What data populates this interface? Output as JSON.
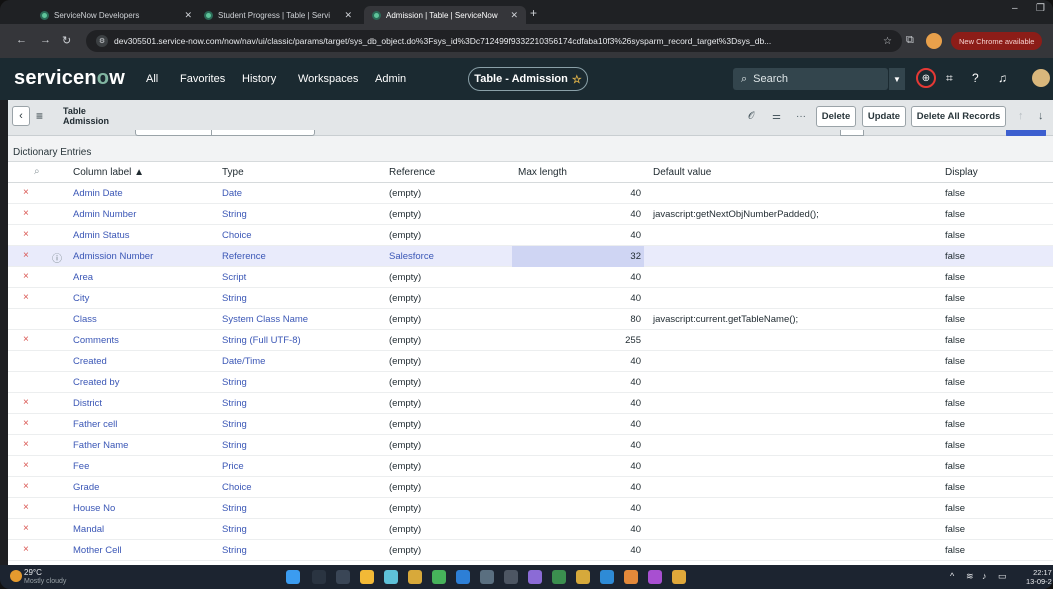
{
  "browser": {
    "tabs": [
      {
        "title": "ServiceNow Developers",
        "active": false
      },
      {
        "title": "Student Progress | Table | Servi",
        "active": false
      },
      {
        "title": "Admission | Table | ServiceNow",
        "active": true
      }
    ],
    "new_tab": "+",
    "url": "dev305501.service-now.com/now/nav/ui/classic/params/target/sys_db_object.do%3Fsys_id%3Dc712499f9332210356174cdfaba10f3%26sysparm_record_target%3Dsys_db...",
    "update_pill": "New Chrome available"
  },
  "header": {
    "logo_left": "servicen",
    "logo_o": "o",
    "logo_right": "w",
    "menu": [
      "All",
      "Favorites",
      "History",
      "Workspaces",
      "Admin"
    ],
    "context": "Table - Admission",
    "context_star": "☆",
    "search_placeholder": "Search"
  },
  "form": {
    "title_line1": "Table",
    "title_line2": "Admission",
    "buttons": {
      "delete": "Delete",
      "update": "Update",
      "delete_all": "Delete All Records"
    }
  },
  "related_list": {
    "title": "Dictionary Entries",
    "columns": {
      "label": "Column label ▲",
      "type": "Type",
      "reference": "Reference",
      "max_length": "Max length",
      "default_value": "Default value",
      "display": "Display"
    },
    "rows": [
      {
        "del": "×",
        "info": "",
        "label": "Admin Date",
        "type": "Date",
        "reference": "(empty)",
        "max": "40",
        "default": "",
        "display": "false"
      },
      {
        "del": "×",
        "info": "",
        "label": "Admin Number",
        "type": "String",
        "reference": "(empty)",
        "max": "40",
        "default": "javascript:getNextObjNumberPadded();",
        "display": "false"
      },
      {
        "del": "×",
        "info": "",
        "label": "Admin Status",
        "type": "Choice",
        "reference": "(empty)",
        "max": "40",
        "default": "",
        "display": "false"
      },
      {
        "del": "×",
        "info": "ⓘ",
        "label": "Admission Number",
        "type": "Reference",
        "reference": "Salesforce",
        "max": "32",
        "default": "",
        "display": "false"
      },
      {
        "del": "×",
        "info": "",
        "label": "Area",
        "type": "Script",
        "reference": "(empty)",
        "max": "40",
        "default": "",
        "display": "false"
      },
      {
        "del": "×",
        "info": "",
        "label": "City",
        "type": "String",
        "reference": "(empty)",
        "max": "40",
        "default": "",
        "display": "false"
      },
      {
        "del": "",
        "info": "",
        "label": "Class",
        "type": "System Class Name",
        "reference": "(empty)",
        "max": "80",
        "default": "javascript:current.getTableName();",
        "display": "false"
      },
      {
        "del": "×",
        "info": "",
        "label": "Comments",
        "type": "String (Full UTF-8)",
        "reference": "(empty)",
        "max": "255",
        "default": "",
        "display": "false"
      },
      {
        "del": "",
        "info": "",
        "label": "Created",
        "type": "Date/Time",
        "reference": "(empty)",
        "max": "40",
        "default": "",
        "display": "false"
      },
      {
        "del": "",
        "info": "",
        "label": "Created by",
        "type": "String",
        "reference": "(empty)",
        "max": "40",
        "default": "",
        "display": "false"
      },
      {
        "del": "×",
        "info": "",
        "label": "District",
        "type": "String",
        "reference": "(empty)",
        "max": "40",
        "default": "",
        "display": "false"
      },
      {
        "del": "×",
        "info": "",
        "label": "Father cell",
        "type": "String",
        "reference": "(empty)",
        "max": "40",
        "default": "",
        "display": "false"
      },
      {
        "del": "×",
        "info": "",
        "label": "Father Name",
        "type": "String",
        "reference": "(empty)",
        "max": "40",
        "default": "",
        "display": "false"
      },
      {
        "del": "×",
        "info": "",
        "label": "Fee",
        "type": "Price",
        "reference": "(empty)",
        "max": "40",
        "default": "",
        "display": "false"
      },
      {
        "del": "×",
        "info": "",
        "label": "Grade",
        "type": "Choice",
        "reference": "(empty)",
        "max": "40",
        "default": "",
        "display": "false"
      },
      {
        "del": "×",
        "info": "",
        "label": "House No",
        "type": "String",
        "reference": "(empty)",
        "max": "40",
        "default": "",
        "display": "false"
      },
      {
        "del": "×",
        "info": "",
        "label": "Mandal",
        "type": "String",
        "reference": "(empty)",
        "max": "40",
        "default": "",
        "display": "false"
      },
      {
        "del": "×",
        "info": "",
        "label": "Mother Cell",
        "type": "String",
        "reference": "(empty)",
        "max": "40",
        "default": "",
        "display": "false"
      }
    ]
  },
  "taskbar": {
    "temp": "29°C",
    "weather": "Mostly cloudy",
    "time": "22:17",
    "date": "13-09-2"
  },
  "colors": {
    "link": "#3b57b6",
    "delete": "#d9534f",
    "header_bg": "#1b2a31",
    "highlight_row": "#e9ebfb"
  }
}
